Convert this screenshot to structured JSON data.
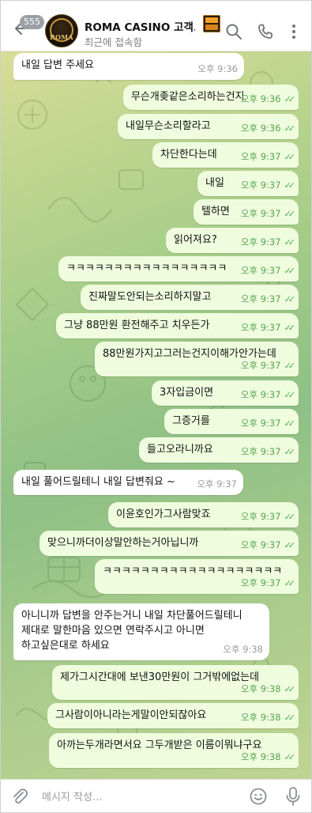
{
  "header": {
    "back_label": "←",
    "unread_count": "555",
    "avatar_text": "ROMA",
    "title": "ROMA CASINO 고객...",
    "status": "최근에 접속함"
  },
  "composer": {
    "placeholder": "메시지 작성..."
  },
  "messages": [
    {
      "dir": "in",
      "text": "내일 답변 주세요",
      "time": "오후 9:36"
    },
    {
      "dir": "out",
      "text": "무슨개좆같은소리하는건지",
      "time": "오후 9:36"
    },
    {
      "dir": "out",
      "text": "내일무슨소리할라고",
      "time": "오후 9:36"
    },
    {
      "dir": "out",
      "text": "차단한다는데",
      "time": "오후 9:37"
    },
    {
      "dir": "out",
      "text": "내일",
      "time": "오후 9:37"
    },
    {
      "dir": "out",
      "text": "텔하면",
      "time": "오후 9:37"
    },
    {
      "dir": "out",
      "text": "읽어져요?",
      "time": "오후 9:37"
    },
    {
      "dir": "out",
      "text": "ㅋㅋㅋㅋㅋㅋㅋㅋㅋㅋㅋㅋㅋㅋㅋㅋㅋ",
      "time": "오후 9:37"
    },
    {
      "dir": "out",
      "text": "진짜말도안되는소리하지말고",
      "time": "오후 9:37"
    },
    {
      "dir": "out",
      "text": "그냥 88만원 환전해주고 치우든가",
      "time": "오후 9:37"
    },
    {
      "dir": "out",
      "text": "88만원가지고그러는건지이해가안가는데",
      "time": "오후 9:37"
    },
    {
      "dir": "out",
      "text": "3자입금이면",
      "time": "오후 9:37"
    },
    {
      "dir": "out",
      "text": "그증거를",
      "time": "오후 9:37"
    },
    {
      "dir": "out",
      "text": "들고오라니까요",
      "time": "오후 9:37"
    },
    {
      "dir": "in",
      "text": "내일 풀어드릴테니 내일 답변줘요 ~",
      "time": "오후 9:37"
    },
    {
      "dir": "out",
      "text": "이윤호인가그사람맞죠",
      "time": "오후 9:37"
    },
    {
      "dir": "out",
      "text": "맞으니까더이상말안하는거아닙니까",
      "time": "오후 9:37"
    },
    {
      "dir": "out",
      "text": "ㅋㅋㅋㅋㅋㅋㅋㅋㅋㅋㅋㅋㅋㅋㅋㅋㅋㅋㅋ",
      "time": "오후 9:37"
    },
    {
      "dir": "in",
      "text": "아니니까 답변을 안주는거니 내일 차단풀어드릴테니\n제대로 말한마음 있으면 연락주시고 아니면\n하고싶은대로 하세요",
      "time": "오후 9:38"
    },
    {
      "dir": "out",
      "text": "제가그시간대에 보낸30만원이 그거밖에없는데",
      "time": "오후 9:38"
    },
    {
      "dir": "out",
      "text": "그사람이아니라는게말이안되잖아요",
      "time": "오후 9:38"
    },
    {
      "dir": "out",
      "text": "아까는두개라면서요 그두개받은 이름이뭐냐구요",
      "time": "오후 9:38"
    }
  ]
}
